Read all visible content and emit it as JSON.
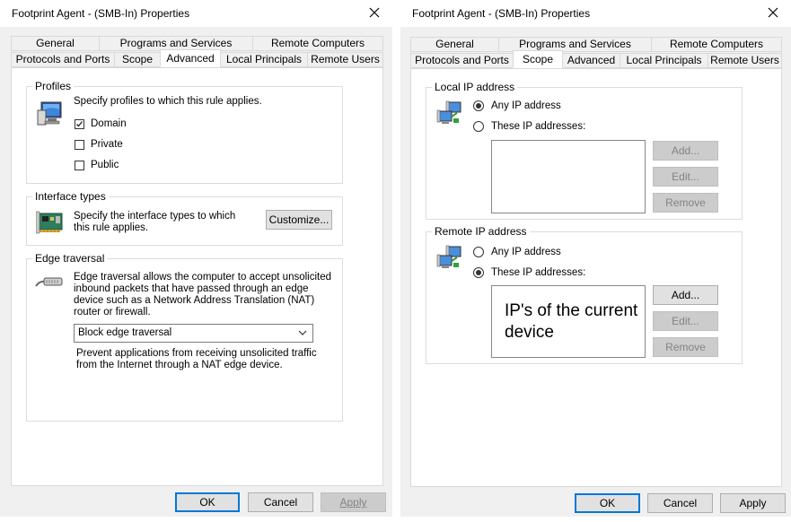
{
  "left_dialog": {
    "title": "Footprint Agent - (SMB-In) Properties",
    "tabs_row1": [
      "General",
      "Programs and Services",
      "Remote Computers"
    ],
    "tabs_row2": [
      "Protocols and Ports",
      "Scope",
      "Advanced",
      "Local Principals",
      "Remote Users"
    ],
    "active_tab": "Advanced",
    "profiles": {
      "label": "Profiles",
      "description": "Specify profiles to which this rule applies.",
      "options": [
        {
          "label": "Domain",
          "checked": true
        },
        {
          "label": "Private",
          "checked": false
        },
        {
          "label": "Public",
          "checked": false
        }
      ]
    },
    "interface_types": {
      "label": "Interface types",
      "description": "Specify the interface types to which this rule applies.",
      "customize_button": "Customize..."
    },
    "edge_traversal": {
      "label": "Edge traversal",
      "description": "Edge traversal allows the computer to accept unsolicited inbound packets that have passed through an edge device such as a Network Address Translation (NAT) router or firewall.",
      "selected": "Block edge traversal",
      "help_text": "Prevent applications from receiving unsolicited traffic from the Internet through a NAT edge device."
    },
    "buttons": {
      "ok": "OK",
      "cancel": "Cancel",
      "apply": "Apply"
    }
  },
  "right_dialog": {
    "title": "Footprint Agent - (SMB-In) Properties",
    "tabs_row1": [
      "General",
      "Programs and Services",
      "Remote Computers"
    ],
    "tabs_row2": [
      "Protocols and Ports",
      "Scope",
      "Advanced",
      "Local Principals",
      "Remote Users"
    ],
    "active_tab": "Scope",
    "local_ip": {
      "label": "Local IP address",
      "any_label": "Any IP address",
      "these_label": "These IP addresses:",
      "selected": "any",
      "add": "Add...",
      "edit": "Edit...",
      "remove": "Remove"
    },
    "remote_ip": {
      "label": "Remote IP address",
      "any_label": "Any IP address",
      "these_label": "These IP addresses:",
      "selected": "these",
      "list_text": "IP's of the current device",
      "add": "Add...",
      "edit": "Edit...",
      "remove": "Remove"
    },
    "buttons": {
      "ok": "OK",
      "cancel": "Cancel",
      "apply": "Apply"
    }
  },
  "colors": {
    "window_bg": "#ffffff",
    "body_bg": "#f0f0f0",
    "default_button_border": "#0078d7",
    "disabled_text": "#838383"
  },
  "icons": [
    "close-icon",
    "computer-monitor-icon",
    "network-card-icon",
    "edge-cable-icon",
    "network-computers-icon",
    "chevron-down-icon",
    "checkmark-icon"
  ]
}
